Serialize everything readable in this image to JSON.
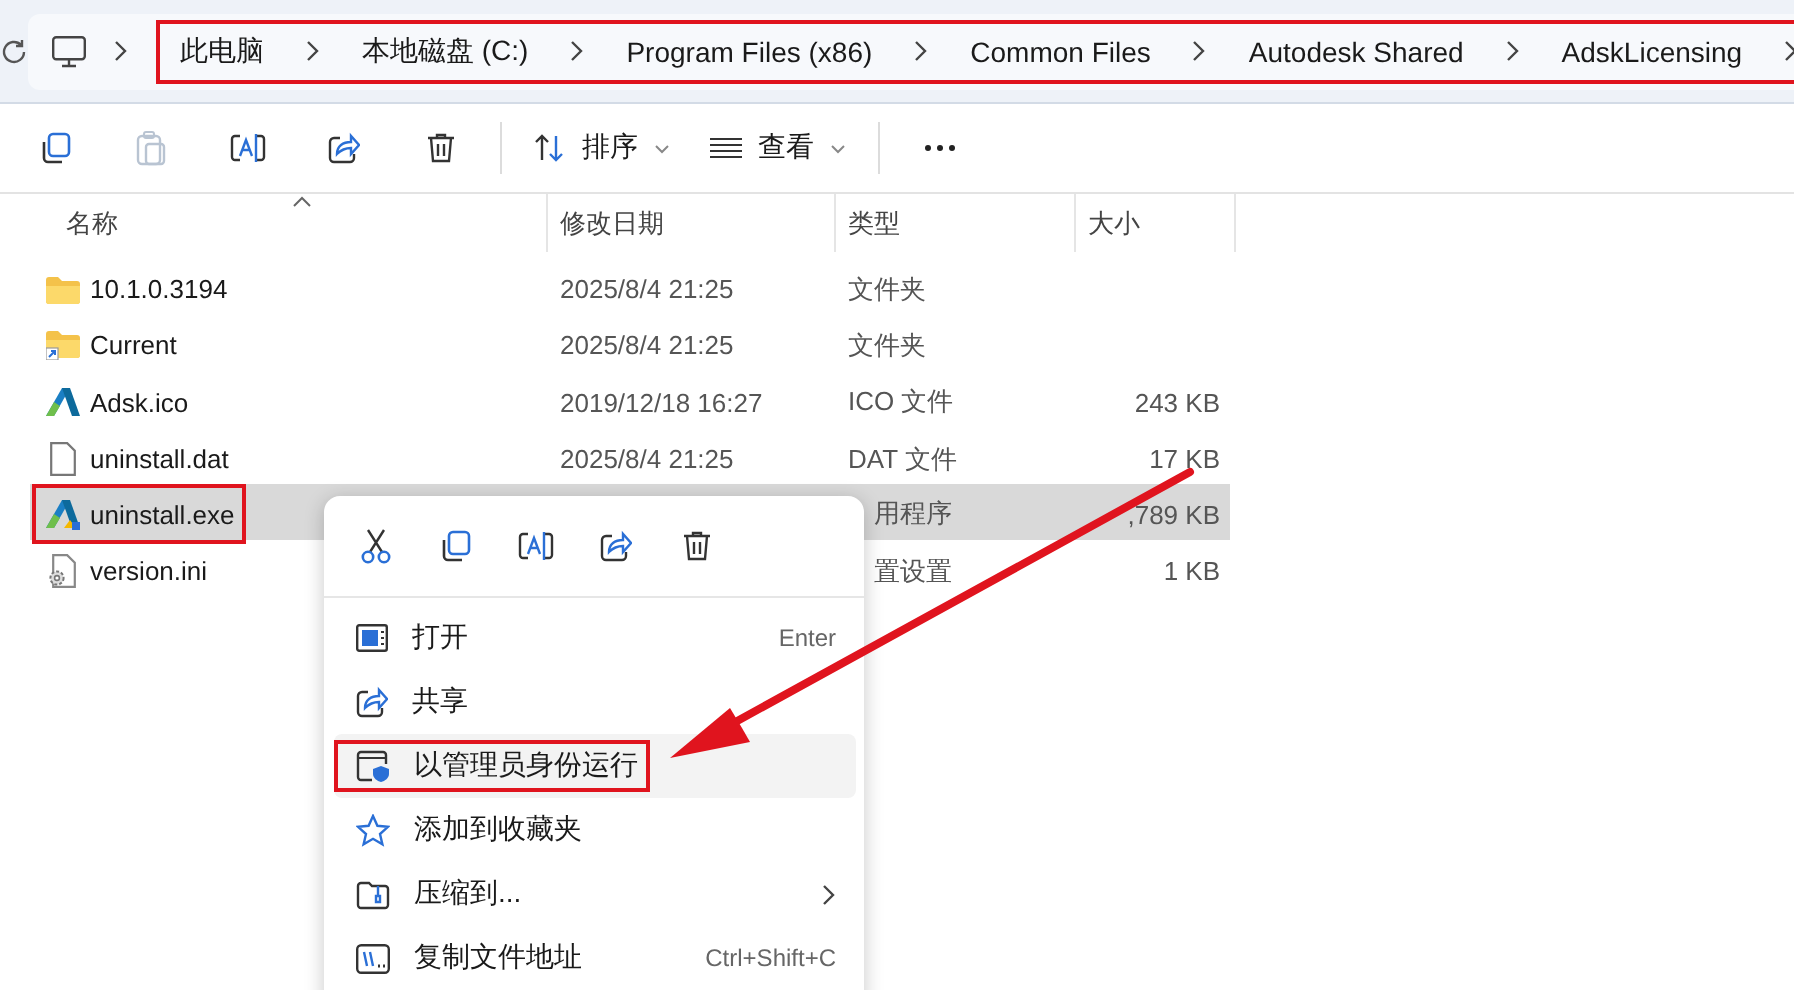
{
  "address_bar": {
    "highlighted": true,
    "crumbs": [
      {
        "label": "此电脑"
      },
      {
        "label": "本地磁盘 (C:)"
      },
      {
        "label": "Program Files (x86)"
      },
      {
        "label": "Common Files"
      },
      {
        "label": "Autodesk Shared"
      },
      {
        "label": "AdskLicensing"
      }
    ]
  },
  "toolbar": {
    "buttons": [
      {
        "kind": "copy",
        "disabled": false
      },
      {
        "kind": "paste",
        "disabled": true
      },
      {
        "kind": "rename",
        "disabled": false
      },
      {
        "kind": "share",
        "disabled": false
      },
      {
        "kind": "delete",
        "disabled": false
      }
    ],
    "sort": {
      "label": "排序"
    },
    "view": {
      "label": "查看"
    }
  },
  "columns": [
    {
      "label": "名称",
      "sorted": true
    },
    {
      "label": "修改日期",
      "sorted": false
    },
    {
      "label": "类型",
      "sorted": false
    },
    {
      "label": "大小",
      "sorted": false
    }
  ],
  "rows": [
    {
      "kind": "folder",
      "name": "10.1.0.3194",
      "date": "2025/8/4 21:25",
      "type": "文件夹",
      "selected": false,
      "highlighted": false
    },
    {
      "kind": "shortcut-folder",
      "name": "Current",
      "date": "2025/8/4 21:25",
      "type": "文件夹",
      "selected": false,
      "highlighted": false
    },
    {
      "kind": "logo",
      "name": "Adsk.ico",
      "date": "2019/12/18 16:27",
      "type": "ICO 文件",
      "size": "243 KB",
      "selected": false,
      "highlighted": false
    },
    {
      "kind": "file",
      "name": "uninstall.dat",
      "date": "2025/8/4 21:25",
      "type": "DAT 文件",
      "size": "17 KB",
      "selected": false,
      "highlighted": false
    },
    {
      "kind": "app",
      "name": "uninstall.exe",
      "type": "用程序",
      "size": ",789 KB",
      "selected": true,
      "highlighted": true
    },
    {
      "kind": "settings",
      "name": "version.ini",
      "type": "置设置",
      "size": "1 KB",
      "selected": false,
      "highlighted": false
    }
  ],
  "context_menu": {
    "actions": [
      {
        "kind": "cut"
      },
      {
        "kind": "copy"
      },
      {
        "kind": "rename"
      },
      {
        "kind": "share"
      },
      {
        "kind": "delete"
      }
    ],
    "items": [
      {
        "kind": "open",
        "label": "打开",
        "shortcut": "Enter",
        "hovered": false,
        "highlighted": false,
        "submenu": false
      },
      {
        "kind": "share",
        "label": "共享",
        "hovered": false,
        "highlighted": false,
        "submenu": false
      },
      {
        "kind": "admin",
        "label": "以管理员身份运行",
        "hovered": true,
        "highlighted": true,
        "submenu": false
      },
      {
        "kind": "star",
        "label": "添加到收藏夹",
        "hovered": false,
        "highlighted": false,
        "submenu": false
      },
      {
        "kind": "zip",
        "label": "压缩到...",
        "hovered": false,
        "highlighted": false,
        "submenu": true
      },
      {
        "kind": "path",
        "label": "复制文件地址",
        "shortcut": "Ctrl+Shift+C",
        "hovered": false,
        "highlighted": false,
        "submenu": false
      }
    ]
  }
}
